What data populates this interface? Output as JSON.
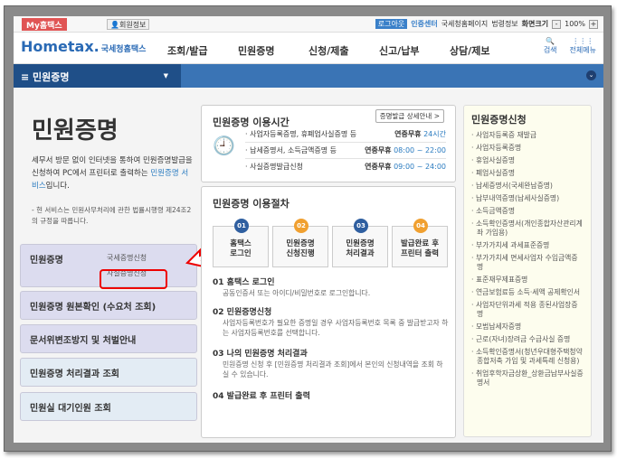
{
  "topbar": {
    "my": "My홈택스",
    "member": "회원정보",
    "logout": "로그아웃",
    "cert": "인증센터",
    "links": [
      "국세청홈페이지",
      "법령정보"
    ],
    "zoom_label": "화면크기",
    "zoom": "100%",
    "minus": "-",
    "plus": "+"
  },
  "header": {
    "logo": "Hometax.",
    "logo_sub": "국세청홈택스",
    "menu": [
      "조회/발급",
      "민원증명",
      "신청/제출",
      "신고/납부",
      "상담/제보"
    ],
    "search": "검색",
    "all": "전체메뉴"
  },
  "nav": {
    "current": "민원증명"
  },
  "left": {
    "title": "민원증명",
    "desc1": "세무서 방문 없이 인터넷을 통하여 민원증명발급을 신청하여 PC에서 프린터로 출력하는 ",
    "desc_link": "민원증명 서비스",
    "desc2": "입니다.",
    "note": "- 현 서비스는 민원사무처리에 관한 법률시행령 제24조2의 규정을 따릅니다.",
    "menu": [
      {
        "label": "민원증명",
        "subs": [
          "국세증명신청",
          "사실증명신청"
        ]
      },
      {
        "label": "민원증명 원본확인 (수요처 조회)"
      },
      {
        "label": "문서위변조방지 및 처벌안내"
      },
      {
        "label": "민원증명 처리결과 조회"
      },
      {
        "label": "민원실 대기인원 조회"
      }
    ]
  },
  "hours": {
    "title": "민원증명 이용시간",
    "detail_btn": "증명발급 상세안내 >",
    "rows": [
      {
        "item": "· 사업자등록증명, 휴폐업사실증명 등",
        "label": "연중무휴",
        "time": "24시간"
      },
      {
        "item": "· 납세증명서, 소득금액증명 등",
        "label": "연중무휴",
        "time": "08:00 ~ 22:00"
      },
      {
        "item": "· 사실증명발급신청",
        "label": "연중무휴",
        "time": "09:00 ~ 24:00"
      }
    ]
  },
  "procedure": {
    "title": "민원증명 이용절차",
    "steps": [
      {
        "num": "01",
        "l1": "홈택스",
        "l2": "로그인",
        "color": "#2f5fa0"
      },
      {
        "num": "02",
        "l1": "민원증명",
        "l2": "신청진행",
        "color": "#f0a030"
      },
      {
        "num": "03",
        "l1": "민원증명",
        "l2": "처리결과",
        "color": "#2f5fa0"
      },
      {
        "num": "04",
        "l1": "발급완료 후",
        "l2": "프린터 출력",
        "color": "#f0a030"
      }
    ],
    "details": [
      {
        "h": "01 홈택스 로그인",
        "d": "공동인증서 또는 아이디/비밀번호로 로그인합니다."
      },
      {
        "h": "02 민원증명신청",
        "d": "사업자등록번호가 필요한 증명일 경우 사업자등록번호 목록 중 발급받고자 하는 사업자등록번호를 선택합니다."
      },
      {
        "h": "03 나의 민원증명 처리결과",
        "d": "민원증명 신청 후 [민원증명 처리결과 조회]에서 본인의 신청내역을 조회 하실 수 있습니다."
      },
      {
        "h": "04 발급완료 후 프린터 출력",
        "d": ""
      }
    ]
  },
  "apply": {
    "title": "민원증명신청",
    "items": [
      "사업자등록증 재발급",
      "사업자등록증명",
      "휴업사실증명",
      "폐업사실증명",
      "납세증명서(국세완납증명)",
      "납부내역증명(납세사실증명)",
      "소득금액증명",
      "소득확인증명서(개인종합자산관리계좌 가입용)",
      "부가가치세 과세표준증명",
      "부가가치세 면세사업자 수입금액증명",
      "표준재무제표증명",
      "연금보험료등 소득·세액 공제확인서",
      "사업자단위과세 적용 종된사업장증명",
      "모범납세자증명",
      "근로(자녀)장려금 수급사실 증명",
      "소득확인증명서(청년우대형주택청약종합저축 가입 및 과세특례 신청용)",
      "취업후학자금상환_상환금납부사실증명서"
    ]
  }
}
